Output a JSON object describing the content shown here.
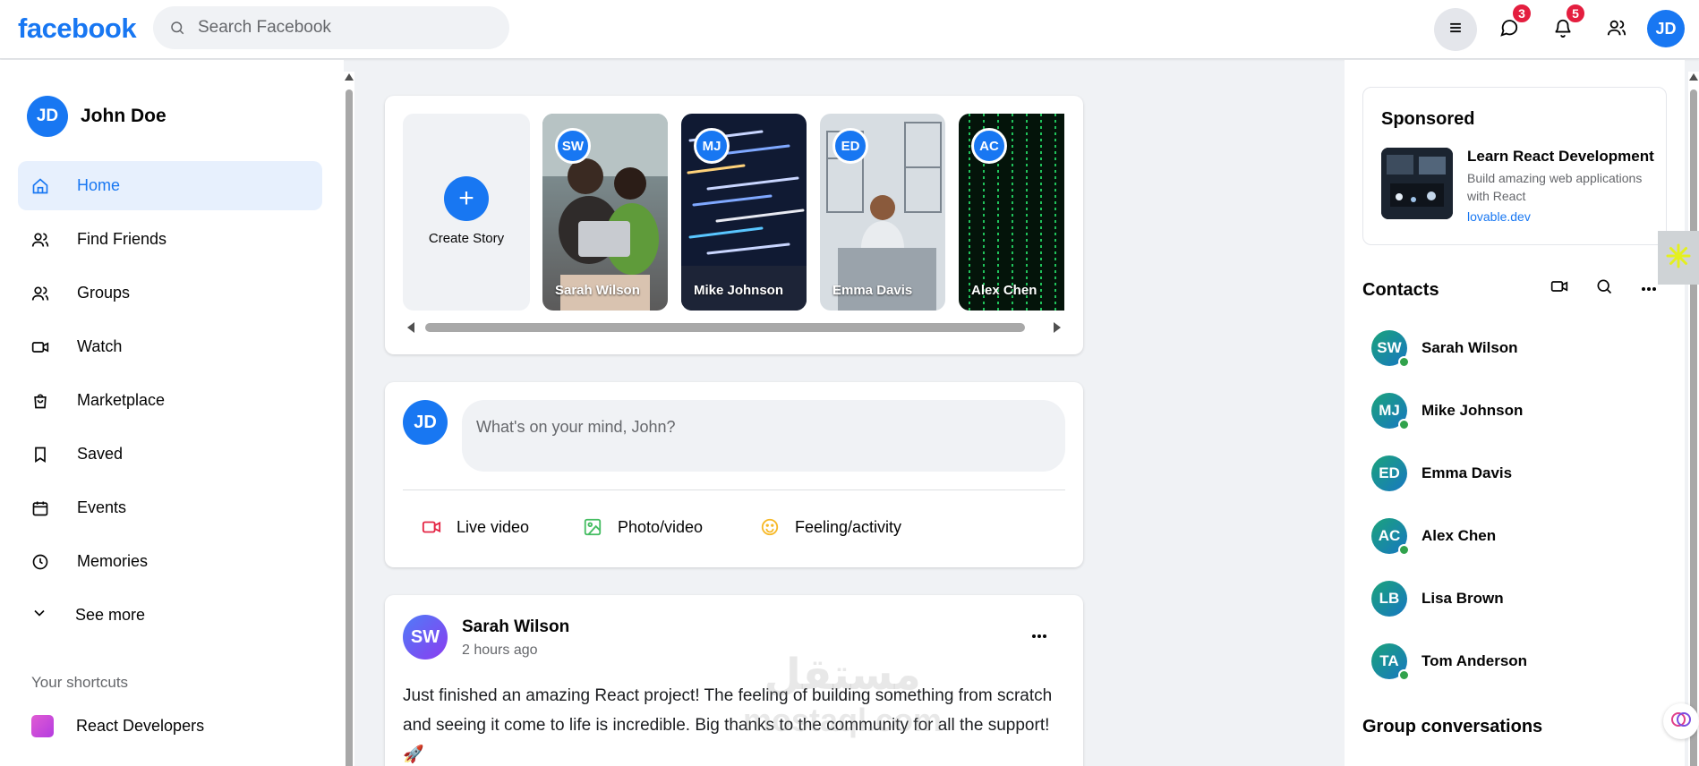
{
  "header": {
    "logo": "facebook",
    "search_placeholder": "Search Facebook",
    "messages_badge": "3",
    "notifications_badge": "5",
    "user_initials": "JD"
  },
  "left": {
    "profile": {
      "initials": "JD",
      "name": "John Doe"
    },
    "nav": [
      {
        "label": "Home",
        "icon": "home-icon",
        "active": true
      },
      {
        "label": "Find Friends",
        "icon": "users-icon"
      },
      {
        "label": "Groups",
        "icon": "users-icon"
      },
      {
        "label": "Watch",
        "icon": "video-icon"
      },
      {
        "label": "Marketplace",
        "icon": "shopping-bag-icon"
      },
      {
        "label": "Saved",
        "icon": "bookmark-icon"
      },
      {
        "label": "Events",
        "icon": "calendar-icon"
      },
      {
        "label": "Memories",
        "icon": "clock-icon"
      }
    ],
    "see_more": "See more",
    "shortcuts_title": "Your shortcuts",
    "shortcut": "React Developers"
  },
  "stories": {
    "create_label": "Create Story",
    "plus": "+",
    "items": [
      {
        "initials": "SW",
        "name": "Sarah Wilson"
      },
      {
        "initials": "MJ",
        "name": "Mike Johnson"
      },
      {
        "initials": "ED",
        "name": "Emma Davis"
      },
      {
        "initials": "AC",
        "name": "Alex Chen"
      }
    ]
  },
  "composer": {
    "initials": "JD",
    "placeholder": "What's on your mind, John?",
    "actions": [
      "Live video",
      "Photo/video",
      "Feeling/activity"
    ]
  },
  "post": {
    "initials": "SW",
    "name": "Sarah Wilson",
    "time": "2 hours ago",
    "text": "Just finished an amazing React project! The feeling of building something from scratch and seeing it come to life is incredible. Big thanks to the community for all the support! 🚀"
  },
  "watermark": {
    "line1": "مستقل",
    "line2": "mostaql.com"
  },
  "sponsored": {
    "title": "Sponsored",
    "ad_title": "Learn React Development",
    "ad_desc": "Build amazing web applications with React",
    "ad_link": "lovable.dev"
  },
  "contacts": {
    "title": "Contacts",
    "items": [
      {
        "initials": "SW",
        "name": "Sarah Wilson"
      },
      {
        "initials": "MJ",
        "name": "Mike Johnson"
      },
      {
        "initials": "ED",
        "name": "Emma Davis"
      },
      {
        "initials": "AC",
        "name": "Alex Chen"
      },
      {
        "initials": "LB",
        "name": "Lisa Brown"
      },
      {
        "initials": "TA",
        "name": "Tom Anderson"
      }
    ],
    "group_title": "Group conversations"
  },
  "colors": {
    "brand": "#1877f2",
    "badge": "#e41e3f",
    "online": "#31a24c"
  }
}
